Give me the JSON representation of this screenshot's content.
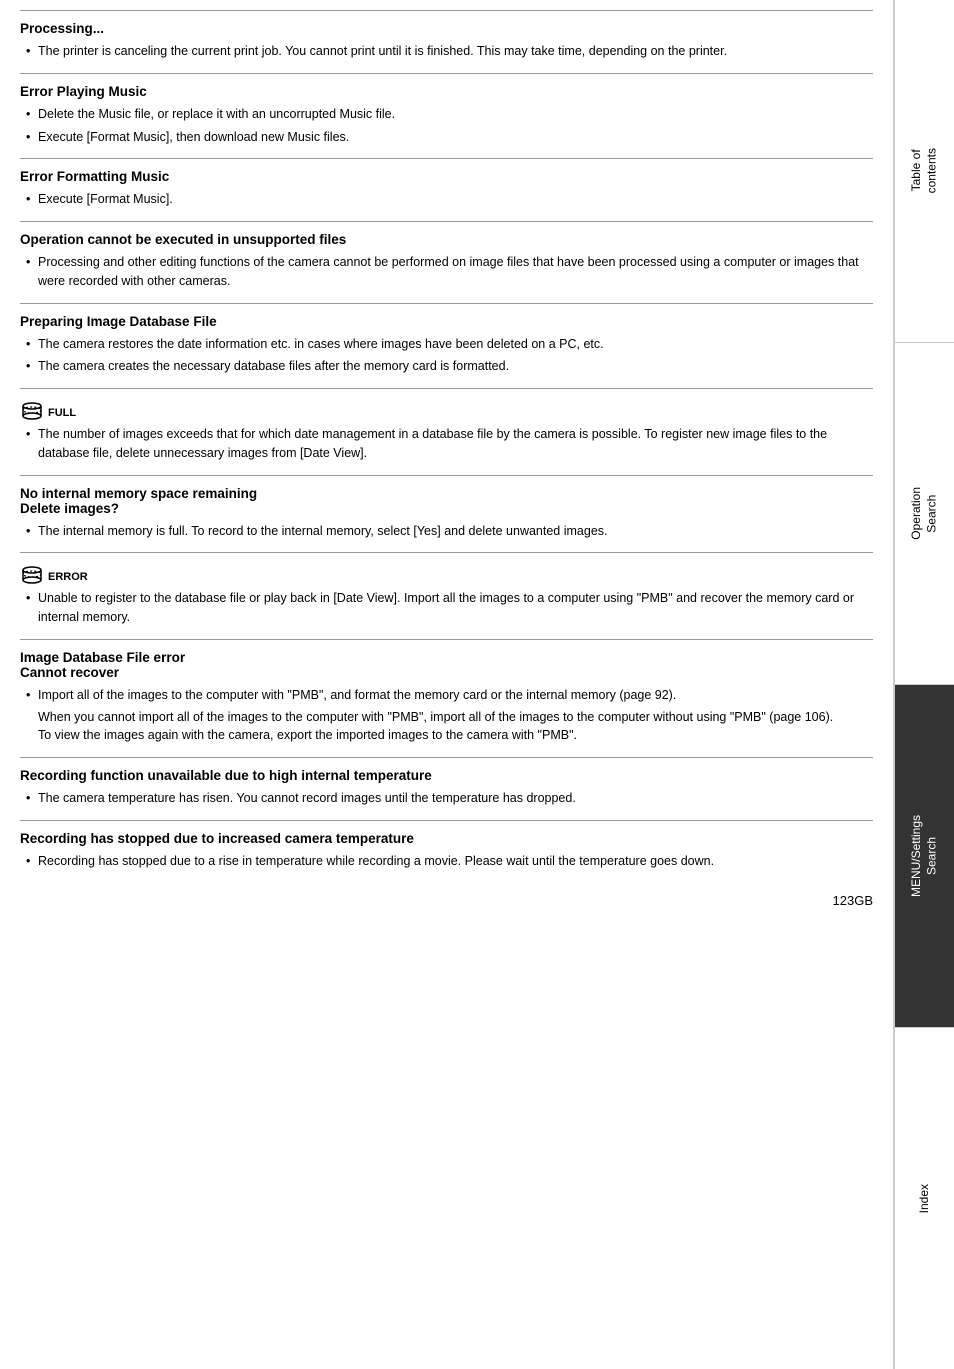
{
  "page": {
    "number": "123GB",
    "sections": [
      {
        "id": "processing",
        "title": "Processing...",
        "bullets": [
          "The printer is canceling the current print job. You cannot print until it is finished. This may take time, depending on the printer."
        ]
      },
      {
        "id": "error-playing-music",
        "title": "Error Playing Music",
        "bullets": [
          "Delete the Music file, or replace it with an uncorrupted Music file.",
          "Execute [Format Music], then download new Music files."
        ]
      },
      {
        "id": "error-formatting-music",
        "title": "Error Formatting Music",
        "bullets": [
          "Execute [Format Music]."
        ]
      },
      {
        "id": "operation-unsupported",
        "title": "Operation cannot be executed in unsupported files",
        "bullets": [
          "Processing and other editing functions of the camera cannot be performed on image files that have been processed using a computer or images that were recorded with other cameras."
        ]
      },
      {
        "id": "preparing-image-db",
        "title": "Preparing Image Database File",
        "bullets": [
          "The camera restores the date information etc. in cases where images have been deleted on a PC, etc.",
          "The camera creates the necessary database files after the memory card is formatted."
        ]
      },
      {
        "id": "db-full",
        "title": null,
        "icon": "db-full",
        "icon_label": "FULL",
        "bullets": [
          "The number of images exceeds that for which date management in a database file by the camera is possible. To register new image files to the database file, delete unnecessary images from [Date View]."
        ]
      },
      {
        "id": "no-internal-memory",
        "title": "No internal memory space remaining\nDelete images?",
        "bullets": [
          "The internal memory is full. To record to the internal memory, select [Yes] and delete unwanted images."
        ]
      },
      {
        "id": "db-error",
        "title": null,
        "icon": "db-error",
        "icon_label": "ERROR",
        "bullets": [
          "Unable to register to the database file or play back in [Date View]. Import all the images to a computer using \"PMB\" and recover the memory card or internal memory."
        ]
      },
      {
        "id": "image-db-error",
        "title": "Image Database File error\nCannot recover",
        "bullets": [
          "Import all of the images to the computer with \"PMB\", and format the memory card or the internal memory (page 92).",
          "When you cannot import all of the images to the computer with \"PMB\", import all of the images to the computer without using \"PMB\" (page 106).",
          "To view the images again with the camera, export the imported images to the camera with \"PMB\"."
        ],
        "sub_bullets": true
      },
      {
        "id": "recording-unavailable",
        "title": "Recording function unavailable due to high internal temperature",
        "bullets": [
          "The camera temperature has risen. You cannot record images until the temperature has dropped."
        ]
      },
      {
        "id": "recording-stopped",
        "title": "Recording has stopped due to increased camera temperature",
        "bullets": [
          "Recording has stopped due to a rise in temperature while recording a movie. Please wait until the temperature goes down."
        ]
      }
    ]
  },
  "sidebar": {
    "sections": [
      {
        "id": "table-of-contents",
        "label": "Table of\ncontents",
        "active": false
      },
      {
        "id": "operation-search",
        "label": "Operation\nSearch",
        "active": false
      },
      {
        "id": "menu-settings-search",
        "label": "MENU/Settings\nSearch",
        "active": true
      },
      {
        "id": "index",
        "label": "Index",
        "active": false
      }
    ]
  }
}
